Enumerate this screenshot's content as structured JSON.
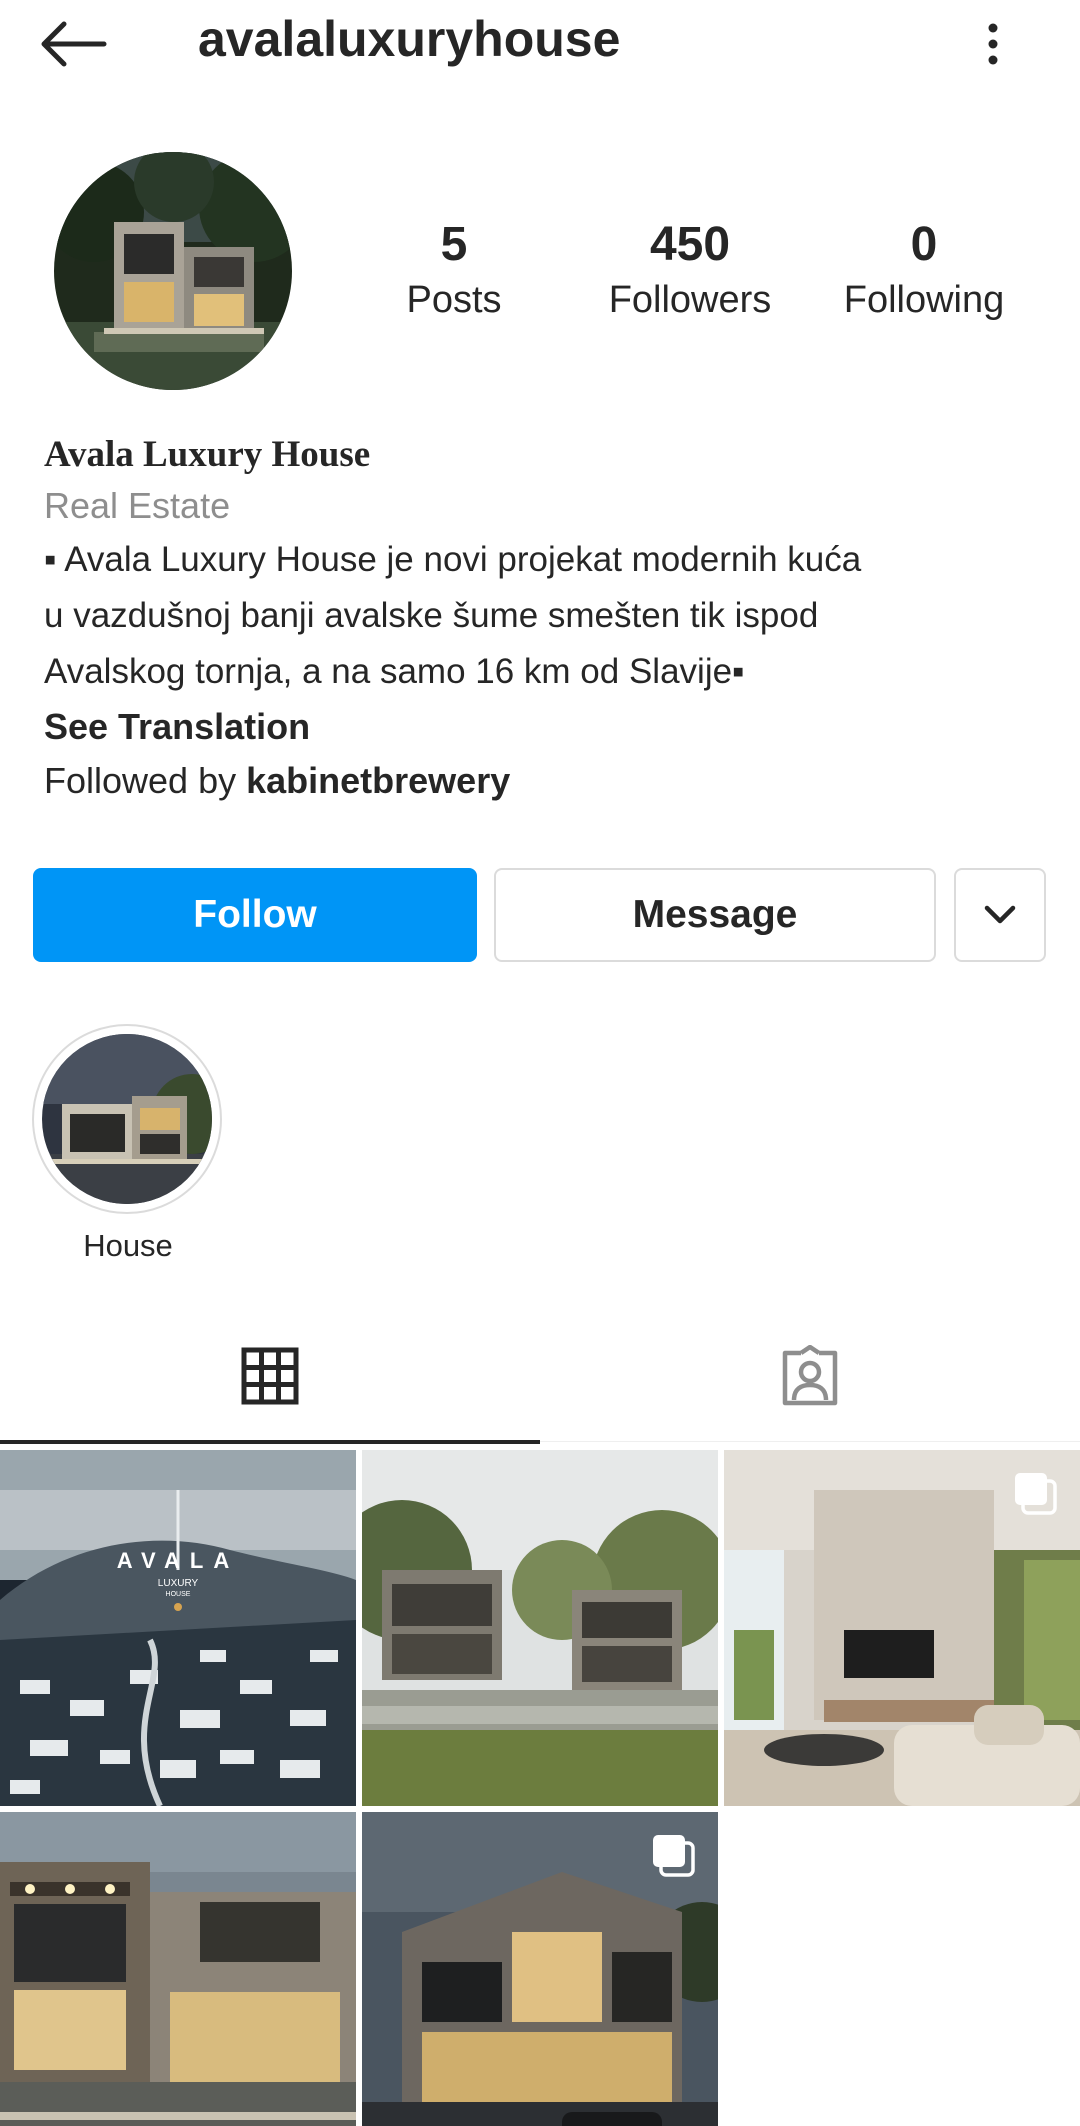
{
  "header": {
    "username": "avalaluxuryhouse",
    "back_icon": "arrow-left-icon",
    "more_icon": "more-vertical-icon"
  },
  "stats": [
    {
      "value": "5",
      "label": "Posts"
    },
    {
      "value": "450",
      "label": "Followers"
    },
    {
      "value": "0",
      "label": "Following"
    }
  ],
  "bio": {
    "full_name": "Avala Luxury House",
    "category": "Real Estate",
    "lines": [
      "▪ Avala Luxury House je novi projekat modernih kuća",
      "u vazdušnoj banji avalske šume smešten tik ispod",
      "Avalskog tornja, a na samo 16 km od Slavije▪"
    ],
    "see_translation": "See Translation",
    "followed_by_prefix": "Followed by ",
    "followed_by_user": "kabinetbrewery"
  },
  "actions": {
    "follow": "Follow",
    "message": "Message",
    "dropdown_icon": "chevron-down-icon"
  },
  "highlights": [
    {
      "label": "House"
    }
  ],
  "tabs": [
    {
      "icon": "grid-icon",
      "active": true
    },
    {
      "icon": "tagged-person-icon",
      "active": false
    }
  ],
  "posts": [
    {
      "logo_text": "AVALA",
      "logo_sub": "LUXURY",
      "logo_sub2": "HOUSE",
      "multi": false
    },
    {
      "multi": false
    },
    {
      "multi": true
    },
    {
      "multi": false
    },
    {
      "multi": true
    }
  ],
  "colors": {
    "primary": "#0095f6",
    "text": "#262626",
    "secondary_text": "#8e8e8e",
    "border": "#dbdbdb"
  }
}
